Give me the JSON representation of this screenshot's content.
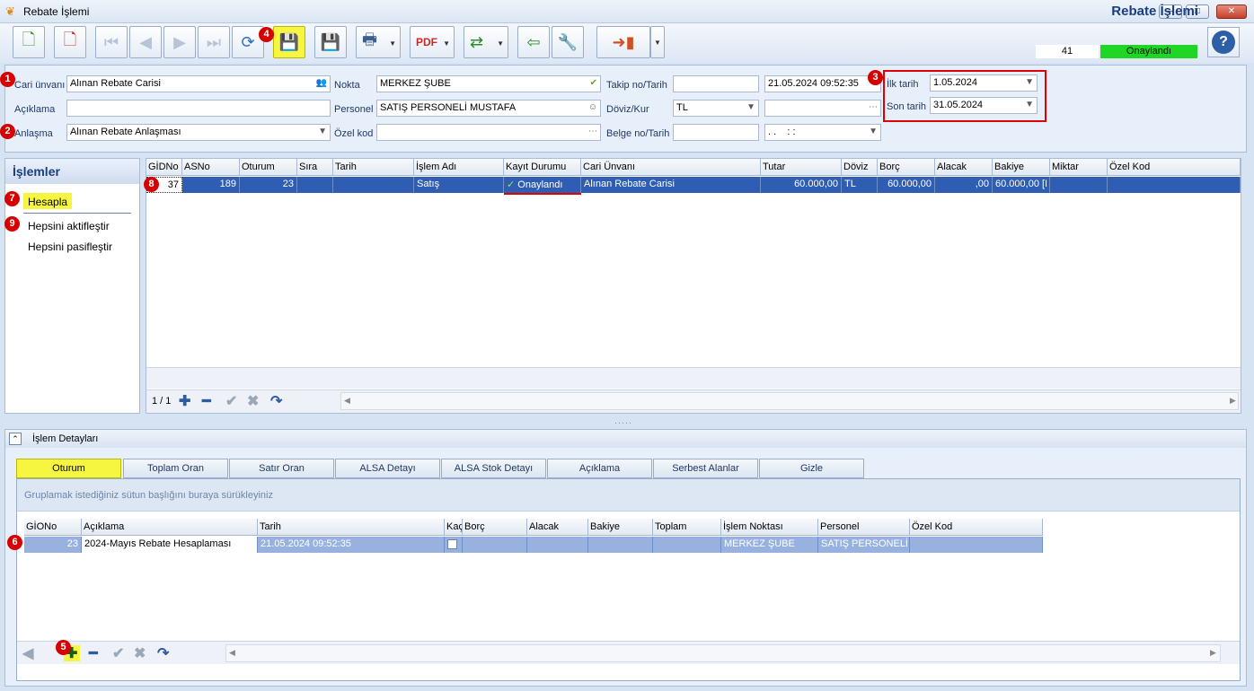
{
  "window": {
    "title": "Rebate İşlemi",
    "minimize": "–",
    "maximize": "□",
    "close": "✕"
  },
  "header": {
    "app_title": "Rebate İşlemi",
    "doc_no": "41",
    "status": "Onaylandı",
    "status_color": "#1fd624"
  },
  "badges": [
    "1",
    "2",
    "3",
    "4",
    "5",
    "6",
    "7",
    "8",
    "9"
  ],
  "form": {
    "cari_unvani": {
      "label": "Cari ünvanı",
      "value": "Alınan Rebate Carisi"
    },
    "aciklama": {
      "label": "Açıklama",
      "value": ""
    },
    "anlasma": {
      "label": "Anlaşma",
      "value": "Alınan Rebate Anlaşması"
    },
    "nokta": {
      "label": "Nokta",
      "value": "MERKEZ ŞUBE"
    },
    "personel": {
      "label": "Personel",
      "value": "SATIŞ PERSONELİ MUSTAFA"
    },
    "ozel_kod": {
      "label": "Özel kod",
      "value": ""
    },
    "takip_no": {
      "label": "Takip no/Tarih",
      "value": "",
      "date": "21.05.2024 09:52:35"
    },
    "doviz_kur": {
      "label": "Döviz/Kur",
      "value": "TL",
      "rate": ""
    },
    "belge_no": {
      "label": "Belge no/Tarih",
      "value": "",
      "date": ". .    : :"
    },
    "ilk_tarih": {
      "label": "İlk tarih",
      "value": "1.05.2024"
    },
    "son_tarih": {
      "label": "Son tarih",
      "value": "31.05.2024"
    }
  },
  "actions": {
    "title": "İşlemler",
    "items": [
      "Hesapla",
      "Hepsini aktifleştir",
      "Hepsini pasifleştir"
    ]
  },
  "main_grid": {
    "columns": [
      "GİDNo",
      "ASNo",
      "Oturum",
      "Sıra",
      "Tarih",
      "İşlem Adı",
      "Kayıt Durumu",
      "Cari Ünvanı",
      "Tutar",
      "Döviz",
      "Borç",
      "Alacak",
      "Bakiye",
      "Miktar",
      "Özel Kod"
    ],
    "row": {
      "gidno": "37",
      "asno": "189",
      "oturum": "23",
      "sira": "",
      "tarih": "",
      "islem_adi": "Satış",
      "kayit_durumu": "Onaylandı",
      "cari_unvani": "Alınan Rebate Carisi",
      "tutar": "60.000,00",
      "doviz": "TL",
      "borc": "60.000,00",
      "alacak": ",00",
      "bakiye": "60.000,00 [I",
      "miktar": "",
      "ozel_kod": ""
    },
    "pager": "1 / 1"
  },
  "details": {
    "title": "İşlem Detayları",
    "tabs": [
      "Oturum",
      "Toplam Oran",
      "Satır Oran",
      "ALSA Detayı",
      "ALSA Stok Detayı",
      "Açıklama",
      "Serbest Alanlar",
      "Gizle"
    ],
    "group_hint": "Gruplamak istediğiniz sütun başlığını buraya sürükleyiniz",
    "columns": [
      "GİONo",
      "Açıklama",
      "Tarih",
      "Kaç",
      "Borç",
      "Alacak",
      "Bakiye",
      "Toplam",
      "İşlem Noktası",
      "Personel",
      "Özel Kod"
    ],
    "row": {
      "giono": "23",
      "aciklama": "2024-Mayıs Rebate Hesaplaması",
      "tarih": "21.05.2024 09:52:35",
      "borc": "",
      "alacak": "",
      "bakiye": "",
      "toplam": "",
      "islem_noktasi": "MERKEZ ŞUBE",
      "personel": "SATIŞ PERSONELİ M",
      "ozel_kod": ""
    }
  }
}
